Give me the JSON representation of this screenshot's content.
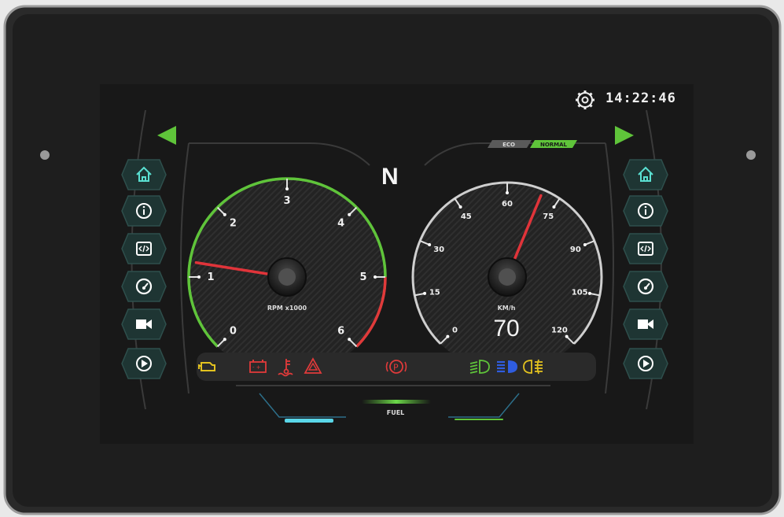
{
  "status": {
    "time": "14:22:46",
    "gear": "N"
  },
  "drive_modes": {
    "eco": "ECO",
    "normal": "NORMAL",
    "active": "NORMAL"
  },
  "tachometer": {
    "ticks": [
      "0",
      "1",
      "2",
      "3",
      "4",
      "5",
      "6"
    ],
    "unit": "RPM x1000",
    "value": 1.2
  },
  "speedometer": {
    "ticks": [
      "0",
      "15",
      "30",
      "45",
      "60",
      "75",
      "90",
      "105",
      "120"
    ],
    "unit": "KM/h",
    "value": 70,
    "value_label": "70"
  },
  "fuel": {
    "label": "FUEL"
  },
  "nav": {
    "left": [
      "home-icon",
      "info-icon",
      "code-icon",
      "gauge-icon",
      "camera-icon",
      "play-icon"
    ],
    "right": [
      "home-icon",
      "info-icon",
      "code-icon",
      "gauge-icon",
      "camera-icon",
      "play-icon"
    ]
  },
  "warnings": [
    "engine-check-icon",
    "battery-icon",
    "coolant-temp-icon",
    "hazard-icon",
    "parking-brake-icon",
    "low-beam-icon",
    "high-beam-icon",
    "fog-light-icon"
  ],
  "colors": {
    "accent_green": "#5fc43a",
    "redline": "#e03a3a",
    "needle": "#e0343a",
    "teal": "#5ae0d2",
    "amber": "#e3c21f",
    "blue": "#2f5de0"
  }
}
